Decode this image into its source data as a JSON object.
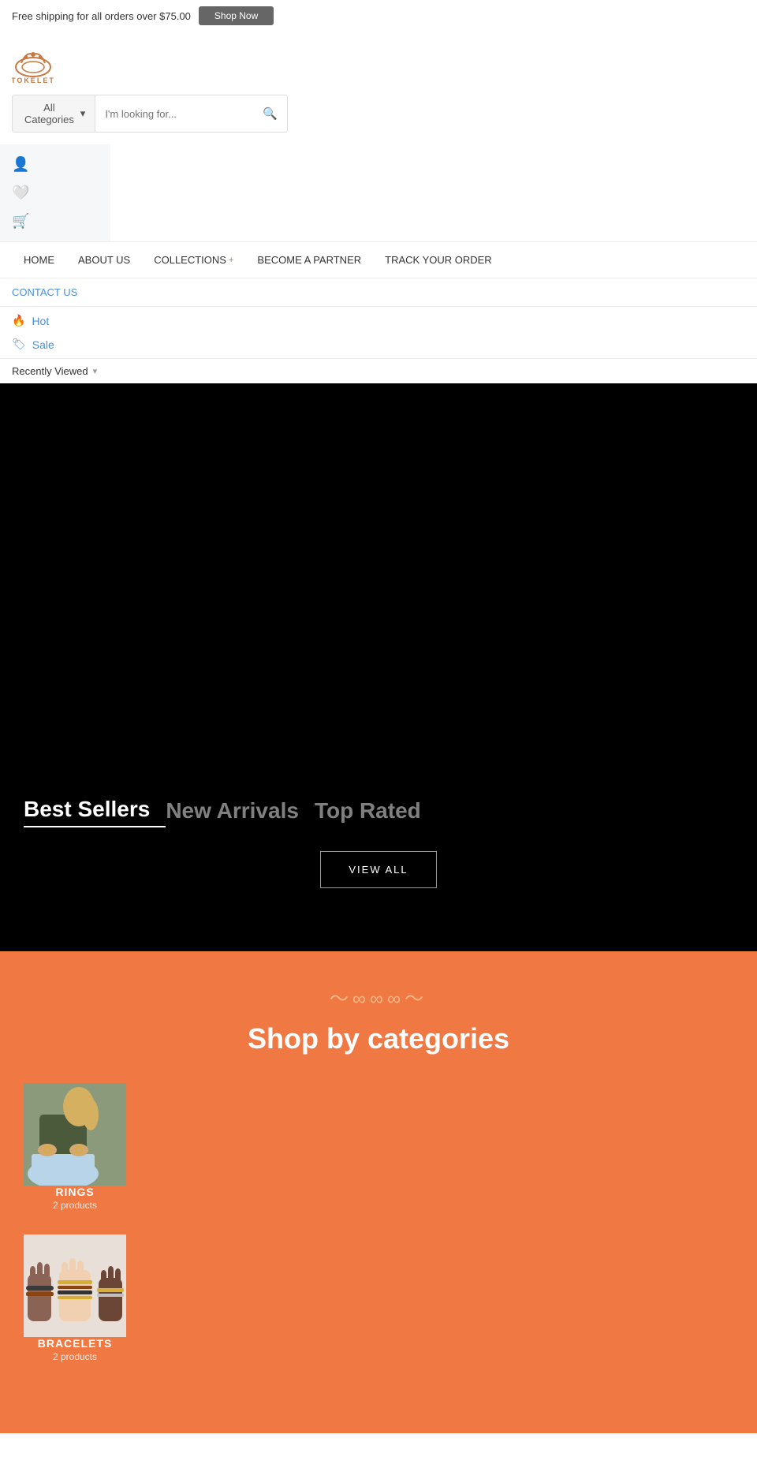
{
  "topbar": {
    "shipping_text": "Free shipping for all orders over $75.00",
    "button_label": "Shop Now"
  },
  "header": {
    "logo_text": "TOKELET",
    "search": {
      "category_label": "All Categories",
      "placeholder": "I'm looking for..."
    }
  },
  "icons": {
    "user": "👤",
    "wishlist": "🤍",
    "cart": "🛒"
  },
  "nav": {
    "items": [
      {
        "label": "HOME",
        "has_plus": false
      },
      {
        "label": "ABOUT US",
        "has_plus": false
      },
      {
        "label": "COLLECTIONS",
        "has_plus": true
      },
      {
        "label": "BECOME A PARTNER",
        "has_plus": false
      },
      {
        "label": "TRACK YOUR ORDER",
        "has_plus": false
      }
    ],
    "contact_label": "CONTACT US",
    "hot_label": "Hot",
    "sale_label": "Sale",
    "recently_viewed_label": "Recently Viewed"
  },
  "product_tabs": [
    {
      "label": "Best Sellers",
      "active": true
    },
    {
      "label": "New Arrivals",
      "active": false
    },
    {
      "label": "Top Rated",
      "active": false
    }
  ],
  "view_all_btn": "VIEW ALL",
  "shop_categories": {
    "ornament": "〜∞∞∞〜",
    "title": "Shop by categories",
    "categories": [
      {
        "name": "RINGS",
        "count": "2 products"
      },
      {
        "name": "BRACELETS",
        "count": "2 products"
      }
    ]
  }
}
